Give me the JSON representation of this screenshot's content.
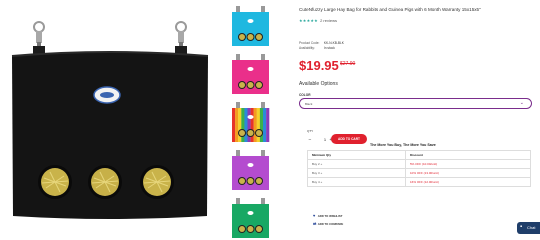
{
  "product": {
    "title": "CuteNfuzzy Large Hay Bag for Rabbits and Guinea Pigs with 6 Month Warranty 15x15x5\"",
    "rating_stars": "★★★★★",
    "review_count": "2 reviews",
    "meta": [
      {
        "key": "Product Code:",
        "value": "KK-N-KB-BLK"
      },
      {
        "key": "Availability:",
        "value": "In stock"
      }
    ],
    "price": "$19.95",
    "old_price": "$27.90",
    "available_options_label": "Available Options",
    "color_label": "COLOR",
    "color_selected": "Black",
    "qty_label": "QTY",
    "qty_value": "1",
    "qty_minus": "−",
    "qty_plus": "+",
    "add_to_cart_label": "ADD TO CART",
    "tier_heading": "The More You Buy, The More You Save",
    "tier_columns": [
      "Minimum Qty",
      "Discount"
    ],
    "tiers": [
      {
        "qty": "Buy 2 +",
        "discount": "5% OFF (10.00/unit)"
      },
      {
        "qty": "Buy 3 +",
        "discount": "10% OFF (13.00/unit)"
      },
      {
        "qty": "Buy 4 +",
        "discount": "16% OFF (12.00/unit)"
      }
    ],
    "wishlist_label": "ADD TO WISHLIST",
    "compare_label": "ADD TO COMPARE"
  },
  "thumbnails": [
    {
      "name": "thumb-blue",
      "color": "#1fb8e0"
    },
    {
      "name": "thumb-pink",
      "color": "#ea2f8a"
    },
    {
      "name": "thumb-rainbow",
      "color": "#e35a2a"
    },
    {
      "name": "thumb-purple",
      "color": "#b44ccf"
    },
    {
      "name": "thumb-green",
      "color": "#18a864"
    }
  ],
  "colors": {
    "accent_red": "#e0212e",
    "accent_purple": "#7a2d8c",
    "bag_black": "#141414",
    "chat_bg": "#1f3e6a"
  },
  "chat": {
    "icon": "chat-icon",
    "label": "Chat"
  }
}
